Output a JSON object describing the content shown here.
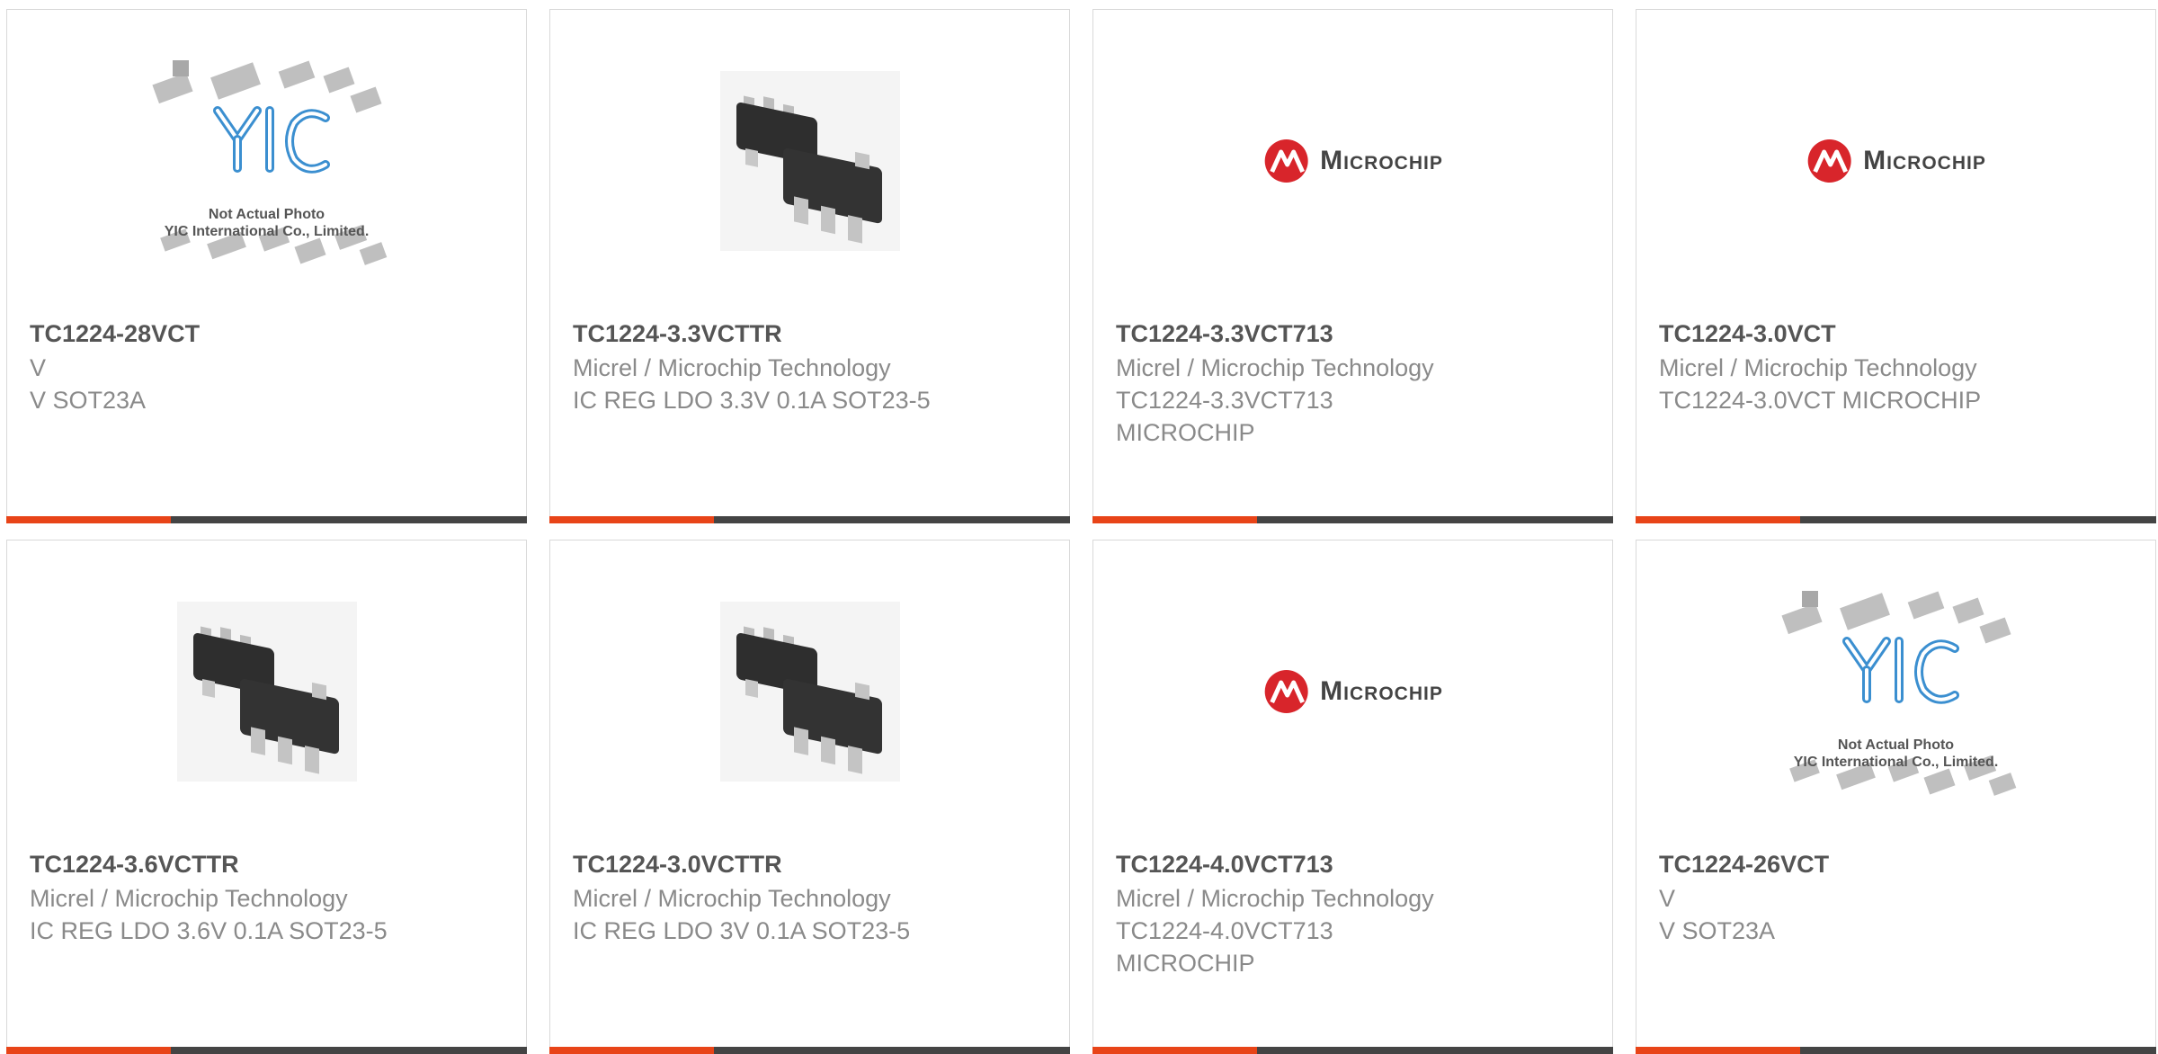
{
  "colors": {
    "accent": "#e84418",
    "bar": "#444444",
    "title": "#555555",
    "text": "#8a8a8a",
    "microchip_red": "#d8252b"
  },
  "cards": [
    {
      "title": "TC1224-28VCT",
      "lines": [
        "V",
        "V SOT23A",
        ""
      ],
      "image": "yic-placeholder-image",
      "image_text": {
        "brand": "YIC",
        "line1": "Not Actual Photo",
        "line2": "YIC International Co., Limited."
      }
    },
    {
      "title": "TC1224-3.3VCTTR",
      "lines": [
        "Micrel / Microchip Technology",
        "IC REG LDO 3.3V 0.1A SOT23-5",
        ""
      ],
      "image": "sot23-5-chip-photo"
    },
    {
      "title": "TC1224-3.3VCT713",
      "lines": [
        "Micrel / Microchip Technology",
        "TC1224-3.3VCT713",
        "MICROCHIP"
      ],
      "image": "microchip-logo",
      "image_text": {
        "brand": "Microchip"
      }
    },
    {
      "title": "TC1224-3.0VCT",
      "lines": [
        "Micrel / Microchip Technology",
        "TC1224-3.0VCT MICROCHIP",
        ""
      ],
      "image": "microchip-logo",
      "image_text": {
        "brand": "Microchip"
      }
    },
    {
      "title": "TC1224-3.6VCTTR",
      "lines": [
        "Micrel / Microchip Technology",
        "IC REG LDO 3.6V 0.1A SOT23-5",
        ""
      ],
      "image": "sot23-5-chip-photo"
    },
    {
      "title": "TC1224-3.0VCTTR",
      "lines": [
        "Micrel / Microchip Technology",
        "IC REG LDO 3V 0.1A SOT23-5",
        ""
      ],
      "image": "sot23-5-chip-photo"
    },
    {
      "title": "TC1224-4.0VCT713",
      "lines": [
        "Micrel / Microchip Technology",
        "TC1224-4.0VCT713",
        "MICROCHIP"
      ],
      "image": "microchip-logo",
      "image_text": {
        "brand": "Microchip"
      }
    },
    {
      "title": "TC1224-26VCT",
      "lines": [
        "V",
        "V SOT23A",
        ""
      ],
      "image": "yic-placeholder-image",
      "image_text": {
        "brand": "YIC",
        "line1": "Not Actual Photo",
        "line2": "YIC International Co., Limited."
      }
    }
  ]
}
